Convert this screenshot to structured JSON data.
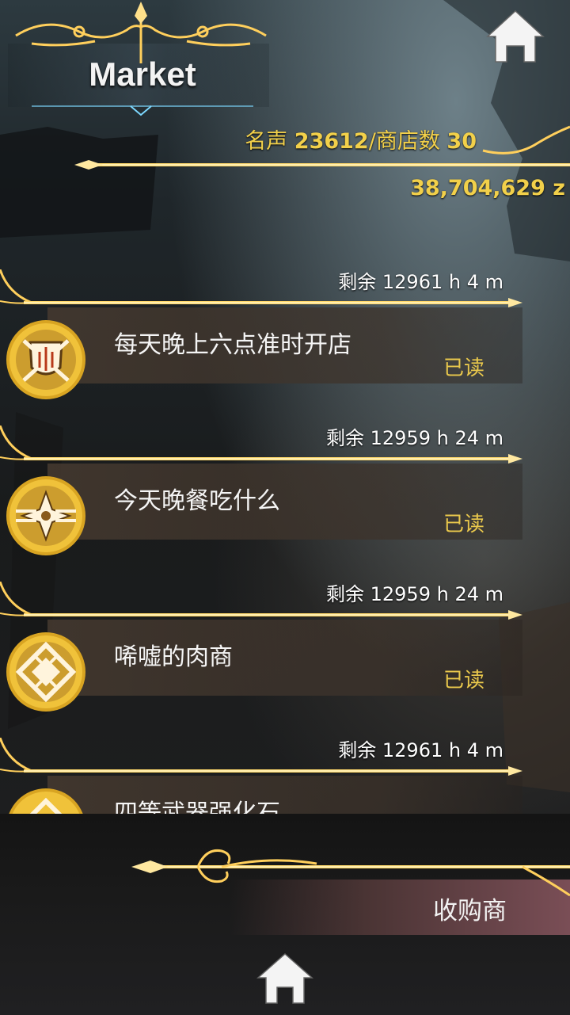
{
  "header": {
    "title": "Market"
  },
  "stats": {
    "fame_label": "名声",
    "fame_value": "23612",
    "shop_label": "/商店数",
    "shop_value": "30",
    "money": "38,704,629 z"
  },
  "orders": [
    {
      "remaining": "剩余 12961 h 4 m",
      "name": "每天晚上六点准时开店",
      "status": "已读",
      "icon": "weapons-shield-icon"
    },
    {
      "remaining": "剩余 12959 h 24 m",
      "name": "今天晚餐吃什么",
      "status": "已读",
      "icon": "compass-star-icon"
    },
    {
      "remaining": "剩余 12959 h 24 m",
      "name": "唏嘘的肉商",
      "status": "已读",
      "icon": "diamond-knot-icon"
    },
    {
      "remaining": "剩余 12961 h 4 m",
      "name": "四等武器强化石",
      "status": "",
      "icon": "diamond-knot-icon"
    }
  ],
  "footer": {
    "buyer_label": "收购商"
  },
  "icons": {
    "home_top": "home-icon",
    "home_bottom": "home-icon"
  },
  "colors": {
    "accent_gold": "#f2d04a",
    "line_gold": "#ffd86a"
  }
}
